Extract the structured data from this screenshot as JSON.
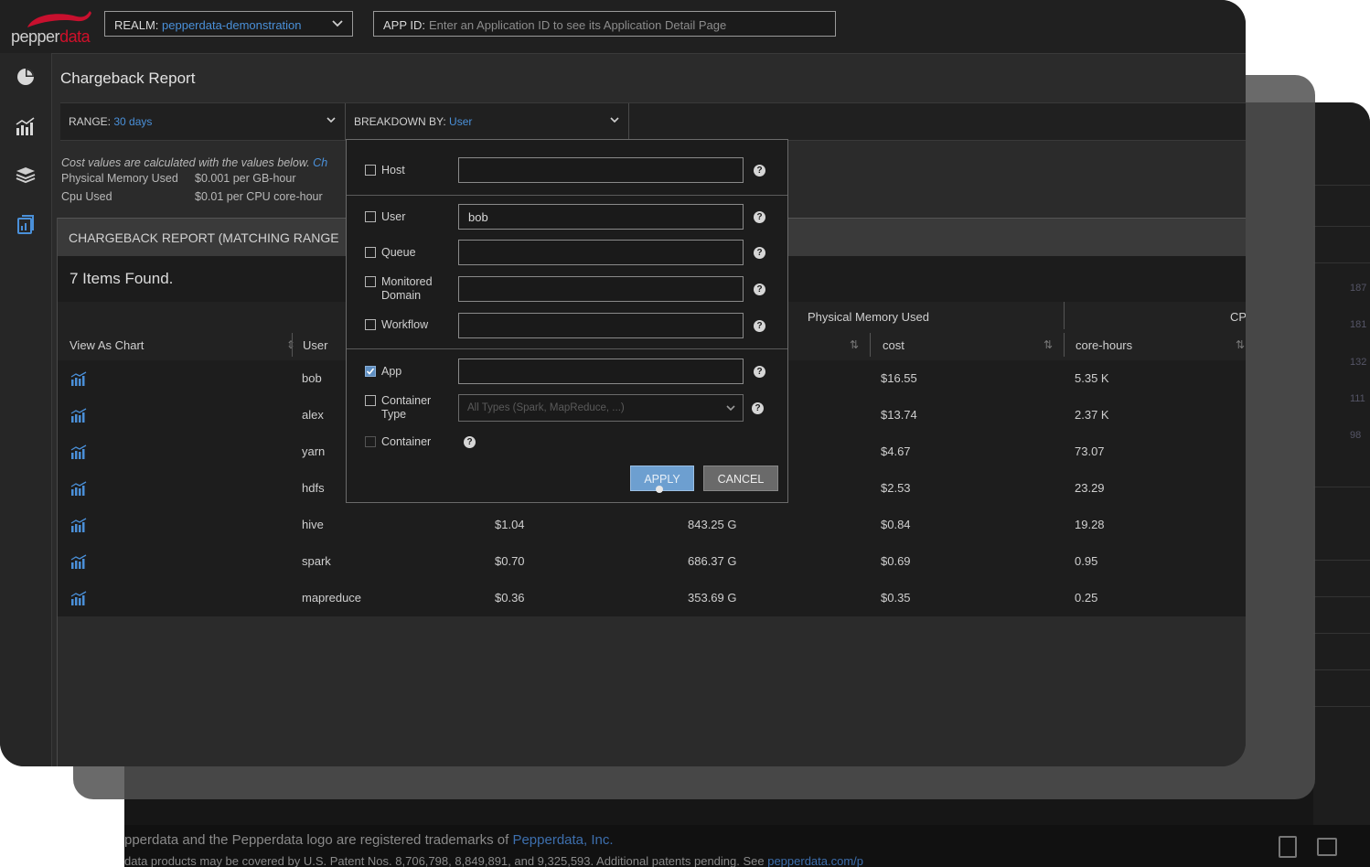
{
  "topbar": {
    "logo_prefix": "pepper",
    "logo_suffix": "data",
    "realm_label": "REALM:",
    "realm_value": "pepperdata-demonstration",
    "appid_label": "APP ID:",
    "appid_placeholder": "Enter an Application ID to see its Application Detail Page"
  },
  "nav": {
    "icons": [
      "pie-chart-icon",
      "bar-chart-icon",
      "database-stack-icon",
      "report-icon"
    ]
  },
  "page": {
    "title": "Chargeback Report"
  },
  "filters": {
    "range_label": "RANGE:",
    "range_value": "30 days",
    "breakdown_label": "BREAKDOWN BY:",
    "breakdown_value": "User"
  },
  "cost_info": {
    "note_text": "Cost values are calculated with the values below.",
    "note_link": "Ch",
    "rates": [
      {
        "label": "Physical Memory Used",
        "value": "$0.001 per GB-hour"
      },
      {
        "label": "Cpu Used",
        "value": "$0.01 per CPU core-hour"
      }
    ]
  },
  "report": {
    "header": "CHARGEBACK REPORT (MATCHING RANGE",
    "items_found": "7 Items Found.",
    "group_headers": [
      "Physical Memory Used",
      "CP"
    ],
    "columns": {
      "view_as_chart": "View As Chart",
      "user": "User",
      "mem_cost": "cost",
      "core_hours": "core-hours"
    },
    "rows": [
      {
        "user": "bob",
        "total": "",
        "gb_hours": "",
        "cost": "$16.55",
        "core_hours": "5.35 K"
      },
      {
        "user": "alex",
        "total": "",
        "gb_hours": "",
        "cost": "$13.74",
        "core_hours": "2.37 K"
      },
      {
        "user": "yarn",
        "total": "",
        "gb_hours": "",
        "cost": "$4.67",
        "core_hours": "73.07"
      },
      {
        "user": "hdfs",
        "total": "",
        "gb_hours": "",
        "cost": "$2.53",
        "core_hours": "23.29"
      },
      {
        "user": "hive",
        "total": "$1.04",
        "gb_hours": "843.25 G",
        "cost": "$0.84",
        "core_hours": "19.28"
      },
      {
        "user": "spark",
        "total": "$0.70",
        "gb_hours": "686.37 G",
        "cost": "$0.69",
        "core_hours": "0.95"
      },
      {
        "user": "mapreduce",
        "total": "$0.36",
        "gb_hours": "353.69 G",
        "cost": "$0.35",
        "core_hours": "0.25"
      }
    ]
  },
  "breakdown_panel": {
    "host_label": "Host",
    "host_value": "",
    "user_label": "User",
    "user_value": "bob",
    "queue_label": "Queue",
    "queue_value": "",
    "monitored_domain_label_1": "Monitored",
    "monitored_domain_label_2": "Domain",
    "monitored_domain_value": "",
    "workflow_label": "Workflow",
    "workflow_value": "",
    "app_label": "App",
    "app_value": "",
    "container_type_label_1": "Container",
    "container_type_label_2": "Type",
    "container_type_placeholder": "All Types (Spark, MapReduce, ...)",
    "container_label": "Container",
    "apply_label": "APPLY",
    "cancel_label": "CANCEL",
    "help_glyph": "?"
  },
  "background_window": {
    "footer_line_1": "pperdata and the Pepperdata logo are registered trademarks of ",
    "footer_link_1": "Pepperdata, Inc.",
    "footer_line_2": "data products may be covered by U.S. Patent Nos. 8,706,798, 8,849,891, and 9,325,593. Additional patents pending. See ",
    "footer_link_2": "pepperdata.com/p",
    "side_values": [
      "187",
      "181",
      "132",
      "111",
      "98"
    ]
  },
  "colors": {
    "accent": "#4a90d9",
    "brand_red": "#d0102a",
    "apply_button": "#6d9fd0"
  }
}
